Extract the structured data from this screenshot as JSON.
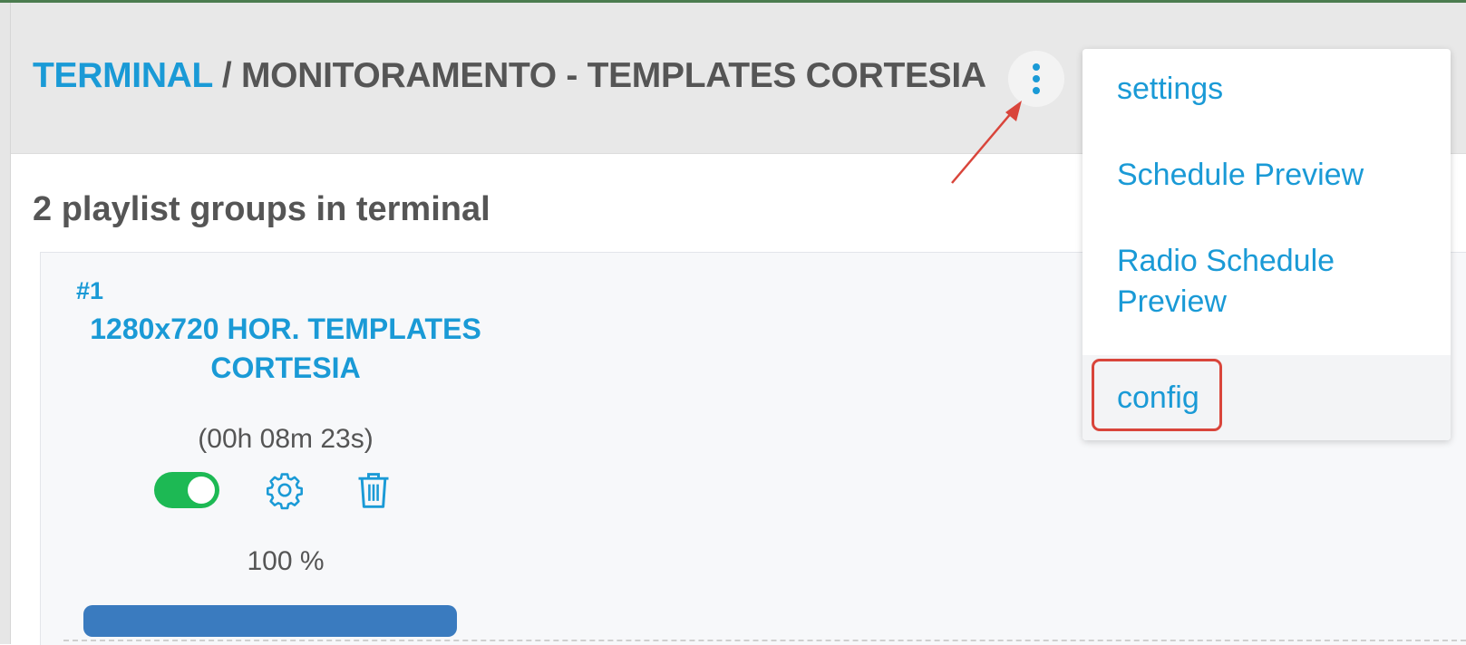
{
  "header": {
    "breadcrumb_link": "TERMINAL",
    "separator": " / ",
    "title": "MONITORAMENTO - TEMPLATES CORTESIA"
  },
  "content": {
    "heading": "2 playlist groups in terminal"
  },
  "playlist_group": {
    "number": "#1",
    "name": "1280x720 HOR. TEMPLATES CORTESIA",
    "duration": "(00h 08m 23s)",
    "enabled": true,
    "percent_label": "100 %",
    "progress": 1.0
  },
  "menu": {
    "items": [
      {
        "label": "settings"
      },
      {
        "label": "Schedule Preview"
      },
      {
        "label": "Radio Schedule Preview"
      },
      {
        "label": "config"
      }
    ]
  },
  "colors": {
    "accent": "#1a9ad6",
    "toggle_on": "#1db954",
    "progress": "#3a7bbf",
    "annotation": "#d9453b"
  }
}
